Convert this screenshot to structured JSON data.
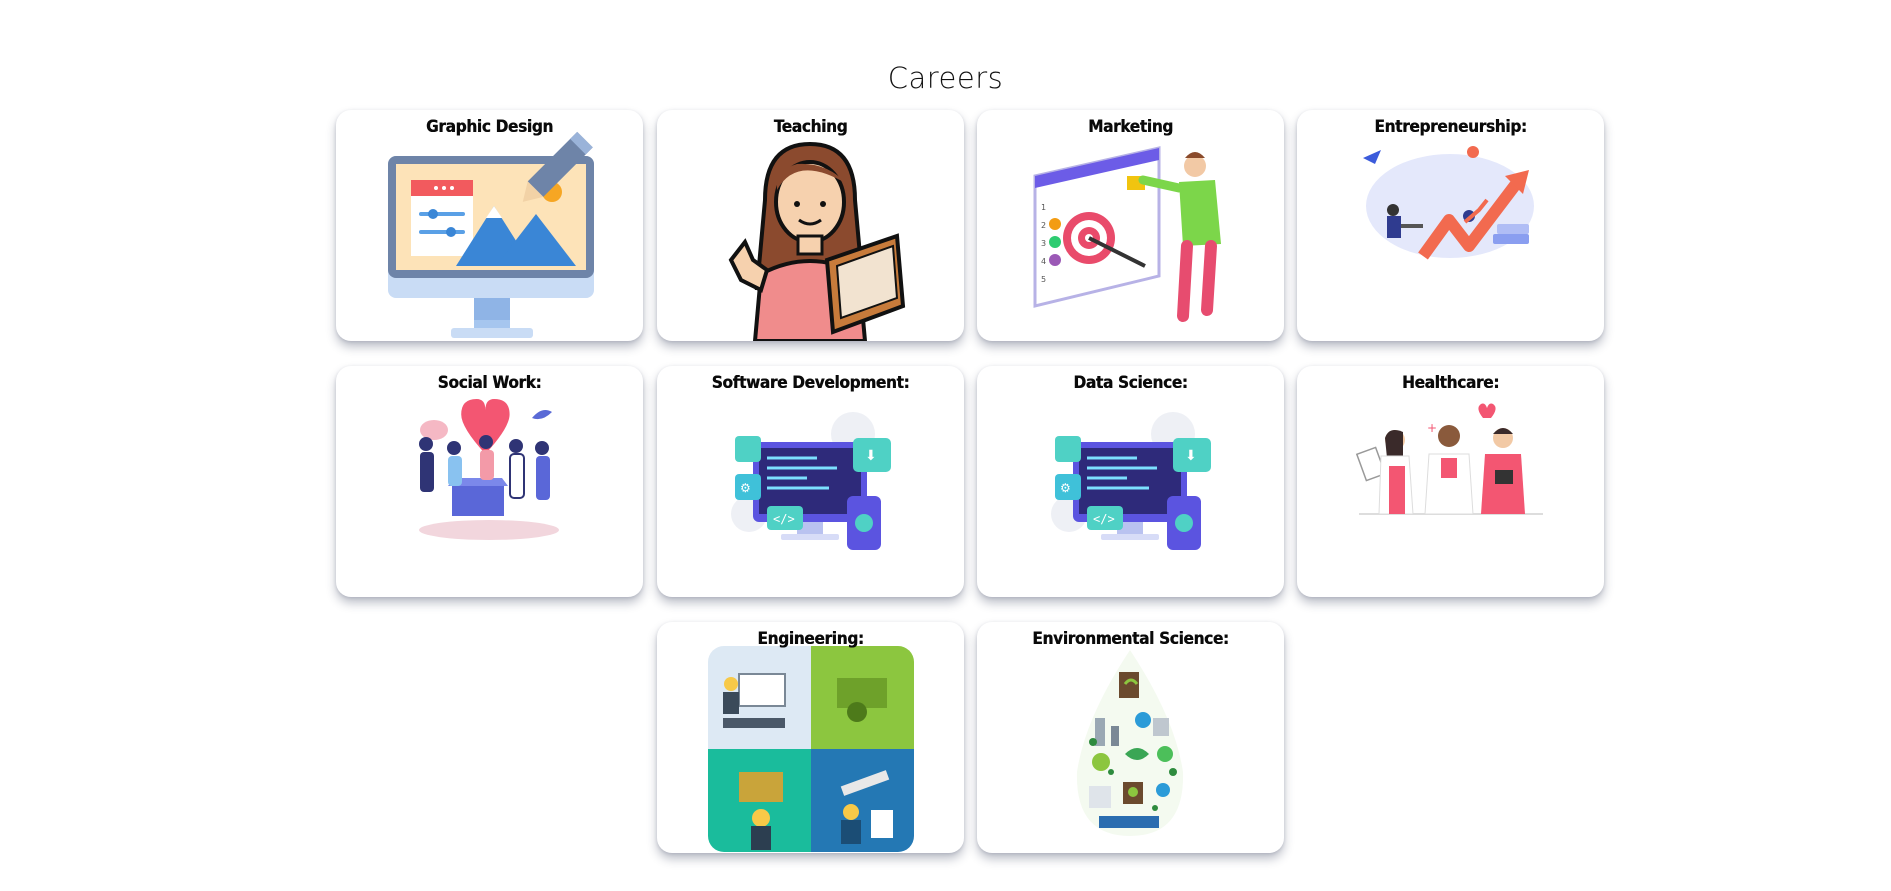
{
  "page": {
    "title": "Careers"
  },
  "cards": [
    {
      "title": "Graphic Design",
      "icon": "graphic-design-icon"
    },
    {
      "title": "Teaching",
      "icon": "teacher-icon"
    },
    {
      "title": "Marketing",
      "icon": "marketing-icon"
    },
    {
      "title": "Entrepreneurship:",
      "icon": "entrepreneurship-icon"
    },
    {
      "title": "Social Work:",
      "icon": "social-work-icon"
    },
    {
      "title": "Software Development:",
      "icon": "software-development-icon"
    },
    {
      "title": "Data Science:",
      "icon": "data-science-icon"
    },
    {
      "title": "Healthcare:",
      "icon": "healthcare-icon"
    },
    {
      "title": "Engineering:",
      "icon": "engineering-icon"
    },
    {
      "title": "Environmental Science:",
      "icon": "environmental-science-icon"
    }
  ],
  "colors": {
    "background": "#ffffff",
    "card_background": "#ffffff",
    "title_text": "#111111"
  }
}
